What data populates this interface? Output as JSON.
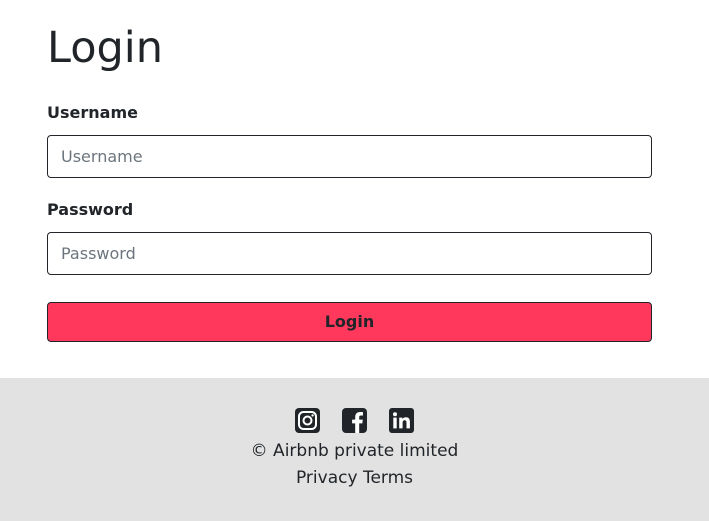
{
  "login": {
    "title": "Login",
    "username_label": "Username",
    "username_placeholder": "Username",
    "username_value": "",
    "password_label": "Password",
    "password_placeholder": "Password",
    "password_value": "",
    "submit_label": "Login"
  },
  "footer": {
    "social_icons": [
      "instagram-icon",
      "facebook-icon",
      "linkedin-icon"
    ],
    "copyright": "© Airbnb private limited",
    "links": [
      {
        "label": "Privacy"
      },
      {
        "label": "Terms"
      }
    ]
  },
  "colors": {
    "accent": "#ff385c",
    "footer_background": "#e2e2e2",
    "text": "#212529"
  }
}
